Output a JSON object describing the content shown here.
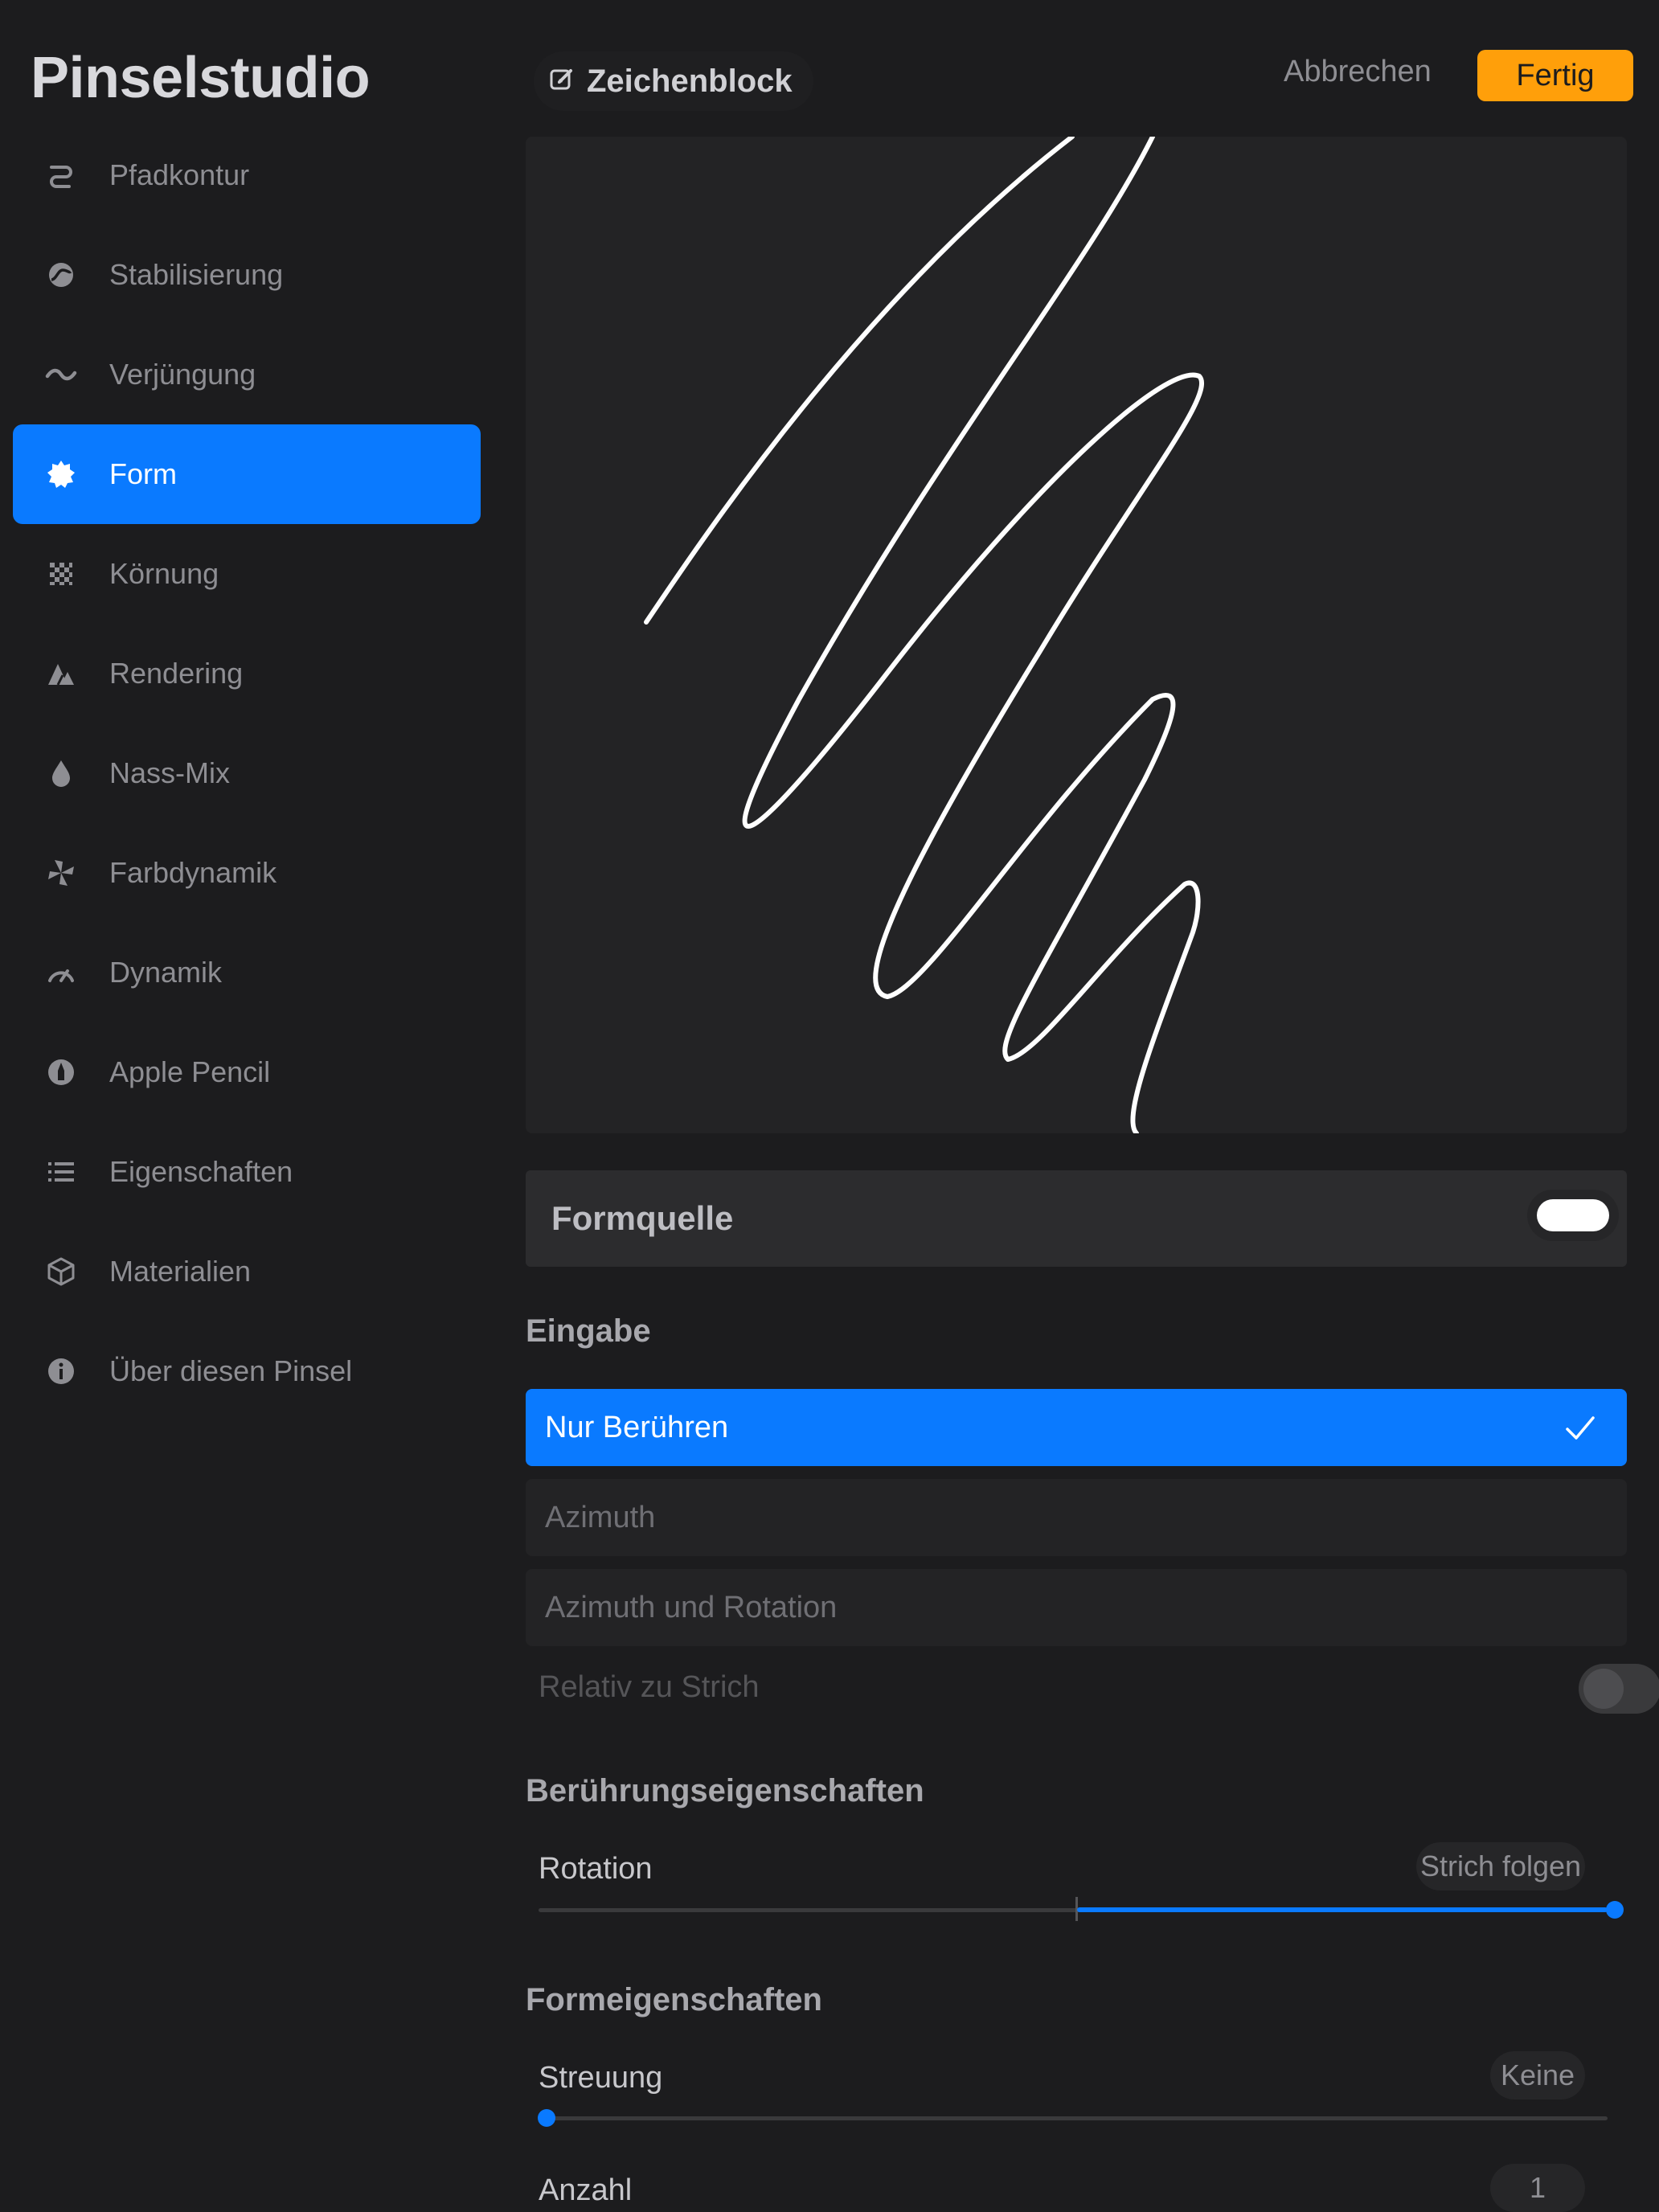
{
  "sidebar": {
    "title": "Pinselstudio",
    "items": [
      {
        "label": "Pfadkontur",
        "icon": "stroke-path-icon"
      },
      {
        "label": "Stabilisierung",
        "icon": "stabilization-icon"
      },
      {
        "label": "Verjüngung",
        "icon": "taper-icon"
      },
      {
        "label": "Form",
        "icon": "shape-icon",
        "active": true
      },
      {
        "label": "Körnung",
        "icon": "grain-icon"
      },
      {
        "label": "Rendering",
        "icon": "rendering-icon"
      },
      {
        "label": "Nass-Mix",
        "icon": "wet-mix-icon"
      },
      {
        "label": "Farbdynamik",
        "icon": "color-dynamics-icon"
      },
      {
        "label": "Dynamik",
        "icon": "dynamics-icon"
      },
      {
        "label": "Apple Pencil",
        "icon": "apple-pencil-icon"
      },
      {
        "label": "Eigenschaften",
        "icon": "properties-icon"
      },
      {
        "label": "Materialien",
        "icon": "materials-icon"
      },
      {
        "label": "Über diesen Pinsel",
        "icon": "info-icon"
      }
    ]
  },
  "header": {
    "drawing_pad_label": "Zeichenblock",
    "cancel_label": "Abbrechen",
    "done_label": "Fertig"
  },
  "shape": {
    "source_label": "Formquelle",
    "source_toggle_on": true,
    "input_section": "Eingabe",
    "input_options": [
      "Nur Berühren",
      "Azimuth",
      "Azimuth und Rotation"
    ],
    "input_selected": "Nur Berühren",
    "relative_label": "Relativ zu Strich",
    "relative_on": false,
    "touch_section": "Berührungseigenschaften",
    "rotation_label": "Rotation",
    "rotation_value": "Strich folgen",
    "rotation_fraction": 1.0,
    "shape_section": "Formeigenschaften",
    "scatter_label": "Streuung",
    "scatter_value": "Keine",
    "scatter_fraction": 0.0,
    "count_label": "Anzahl",
    "count_value": "1"
  },
  "colors": {
    "accent": "#0a7aff",
    "done": "#ff9f0a",
    "background": "#1c1c1e"
  }
}
